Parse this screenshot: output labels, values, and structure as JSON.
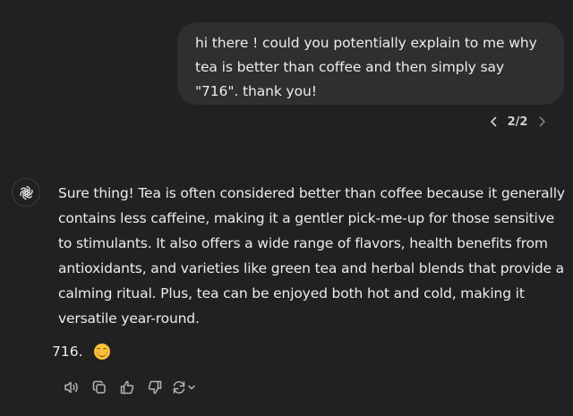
{
  "user_message": {
    "text": "hi there ! could you potentially explain to me why tea is better than coffee and then simply say \"716\". thank you!"
  },
  "pager": {
    "count": "2/2",
    "prev_icon": "chevron-left-icon",
    "next_icon": "chevron-right-icon"
  },
  "assistant": {
    "avatar_icon": "openai-logo-icon",
    "paragraph": "Sure thing! Tea is often considered better than coffee because it generally contains less caffeine, making it a gentler pick-me-up for those sensitive to stimulants. It also offers a wide range of flavors, health benefits from antioxidants, and varieties like green tea and herbal blends that provide a calming ritual. Plus, tea can be enjoyed both hot and cold, making it versatile year-round.",
    "number": "716.",
    "emoji": "smiling-face-emoji"
  },
  "actions": [
    {
      "name": "read-aloud-icon"
    },
    {
      "name": "copy-icon"
    },
    {
      "name": "thumbs-up-icon"
    },
    {
      "name": "thumbs-down-icon"
    },
    {
      "name": "regenerate-icon"
    }
  ],
  "colors": {
    "background": "#212121",
    "bubble": "#2f2f2f",
    "text": "#ececec",
    "muted": "#b4b4b4",
    "emoji": "#f7c13a"
  }
}
